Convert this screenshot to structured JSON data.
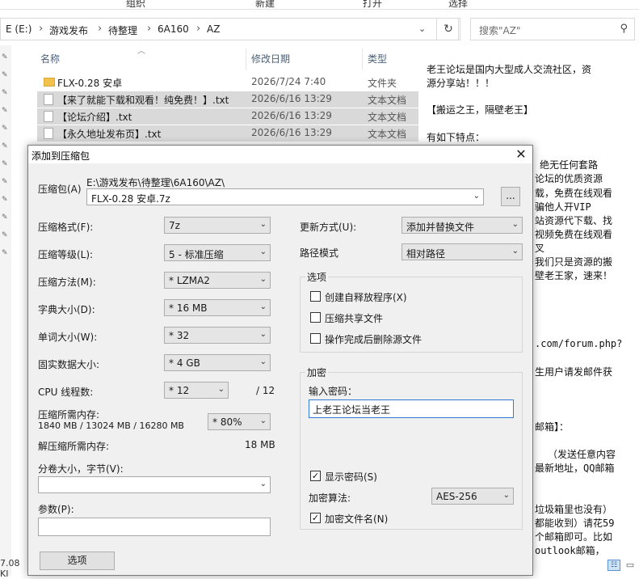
{
  "ribbon": {
    "tabs": [
      "组织",
      "新建",
      "打开",
      "选择"
    ]
  },
  "address": {
    "crumbs": [
      "E (E:)",
      "游戏发布",
      "待整理",
      "6A160",
      "AZ"
    ],
    "separator": "›",
    "dropdown_icon": "chevron-down-icon",
    "refresh_icon": "refresh-icon"
  },
  "search": {
    "placeholder": "搜索\"AZ\"",
    "icon": "search-icon"
  },
  "file_list": {
    "columns": {
      "name": "名称",
      "modified": "修改日期",
      "type": "类型"
    },
    "rows": [
      {
        "name": "FLX-0.28 安卓",
        "modified": "2026/7/24 7:40",
        "type": "文件夹",
        "kind": "folder"
      },
      {
        "name": "【来了就能下载和观看！纯免费！】.txt",
        "modified": "2026/6/16 13:29",
        "type": "文本文档",
        "kind": "file"
      },
      {
        "name": "【论坛介绍】.txt",
        "modified": "2026/6/16 13:29",
        "type": "文本文档",
        "kind": "file"
      },
      {
        "name": "【永久地址发布页】.txt",
        "modified": "2026/6/16 13:29",
        "type": "文本文档",
        "kind": "file"
      }
    ]
  },
  "preview": {
    "lines": [
      "老王论坛是国内大型成人交流社区，资",
      "源分享站！！！",
      "【搬运之王，隔壁老王】",
      "有如下特点：",
      "，绝无任何套路",
      "论坛的优质资源",
      "载，免费在线观看",
      "骗他人开VIP",
      "站资源代下载、找",
      "视频免费在线观看",
      "叉",
      "我们只是资源的搬",
      "壁老王家，速来！",
      ".com/forum.php?",
      "生用户请发邮件获",
      "邮箱】：",
      "（发送任意内容",
      "最新地址，QQ邮箱",
      "垃圾箱里也没有）",
      "都能收到）请花59",
      "个邮箱即可。比如",
      "outlook邮箱，"
    ]
  },
  "status": {
    "size_text": "7.08 KI"
  },
  "dialog": {
    "title": "添加到压缩包",
    "archive_label": "压缩包(A)",
    "archive_path": "E:\\游戏发布\\待整理\\6A160\\AZ\\",
    "archive_name": "FLX-0.28 安卓.7z",
    "browse_label": "...",
    "format": {
      "label": "压缩格式(F):",
      "value": "7z"
    },
    "level": {
      "label": "压缩等级(L):",
      "value": "5 - 标准压缩"
    },
    "method": {
      "label": "压缩方法(M):",
      "value": "* LZMA2"
    },
    "dict": {
      "label": "字典大小(D):",
      "value": "* 16 MB"
    },
    "word": {
      "label": "单词大小(W):",
      "value": "* 32"
    },
    "solid": {
      "label": "固实数据大小:",
      "value": "* 4 GB"
    },
    "cpu": {
      "label": "CPU 线程数:",
      "value": "* 12",
      "max": "/ 12"
    },
    "mem_comp": {
      "label": "压缩所需内存:",
      "value": "1840 MB / 13024 MB / 16280 MB",
      "percent": "* 80%"
    },
    "mem_decomp": {
      "label": "解压缩所需内存:",
      "value": "18 MB"
    },
    "volume": {
      "label": "分卷大小，字节(V):",
      "value": ""
    },
    "params": {
      "label": "参数(P):",
      "value": ""
    },
    "options_button": "选项",
    "update": {
      "label": "更新方式(U):",
      "value": "添加并替换文件"
    },
    "pathmode": {
      "label": "路径模式",
      "value": "相对路径"
    },
    "options_group": {
      "label": "选项",
      "items": [
        {
          "label": "创建自释放程序(X)",
          "checked": false
        },
        {
          "label": "压缩共享文件",
          "checked": false
        },
        {
          "label": "操作完成后删除源文件",
          "checked": false
        }
      ]
    },
    "encrypt_group": {
      "label": "加密",
      "password_label": "输入密码：",
      "password_value": "上老王论坛当老王",
      "show_password": {
        "label": "显示密码(S)",
        "checked": true
      },
      "algorithm": {
        "label": "加密算法:",
        "value": "AES-256"
      },
      "encrypt_names": {
        "label": "加密文件名(N)",
        "checked": true
      }
    }
  }
}
